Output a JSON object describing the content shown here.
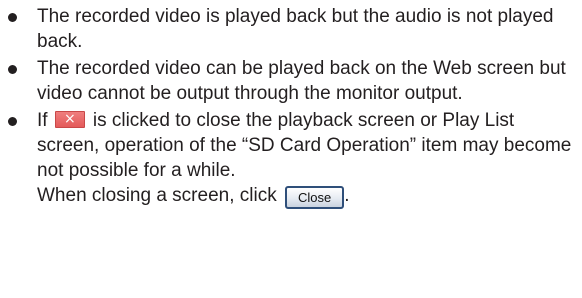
{
  "notes": [
    "The recorded video is played back but the audio is not played back.",
    "The recorded video can be played back on the Web screen but video cannot be output through the monitor output."
  ],
  "note3": {
    "pre": "If",
    "close_x_icon": "×",
    "post": "is clicked to close the playback screen or Play List screen, operation of the “SD Card Operation” item may become not possible for a while.",
    "closing_pre": "When closing a screen, click",
    "close_button_label": "Close",
    "closing_post": "."
  }
}
